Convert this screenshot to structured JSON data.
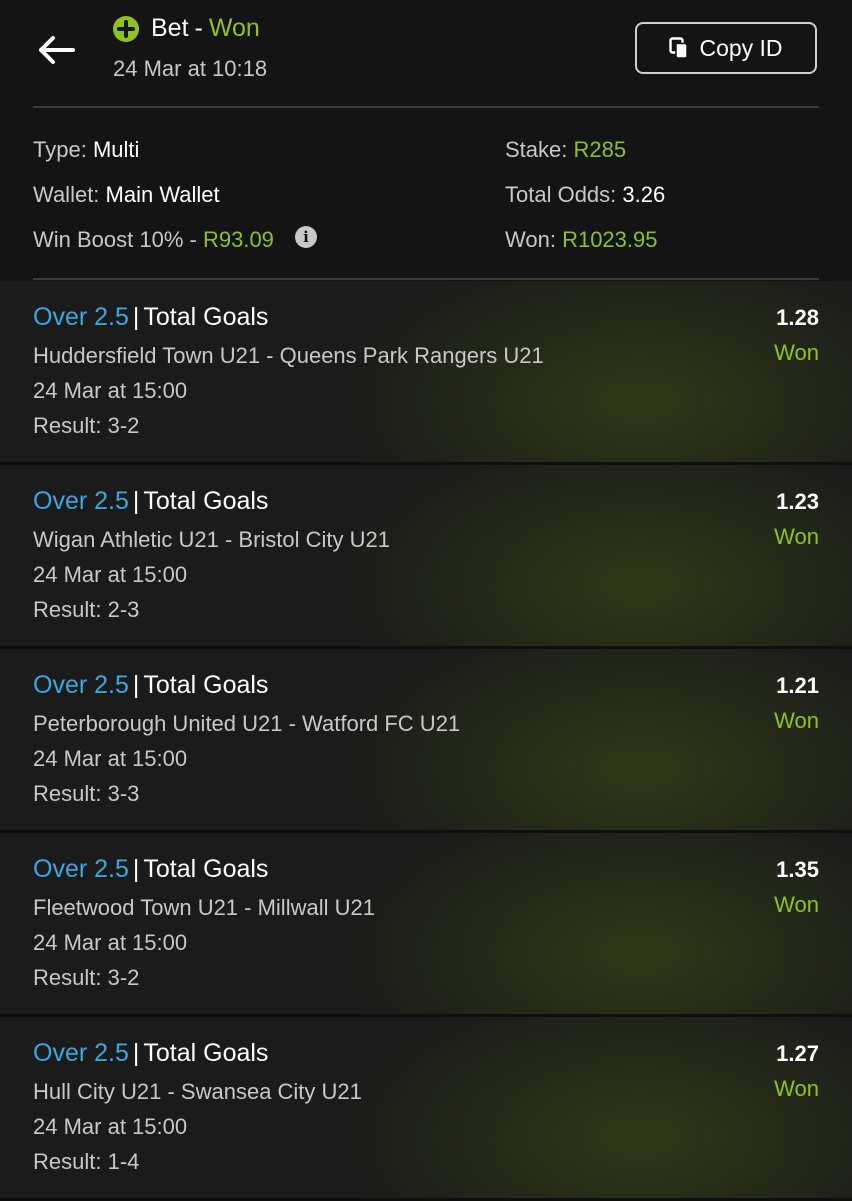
{
  "header": {
    "back_icon": "arrow-left-icon",
    "status_icon": "plus-circle-icon",
    "title_prefix": "Bet",
    "title_separator": "-",
    "title_status": "Won",
    "date": "24 Mar at 10:18",
    "copy_icon": "copy-icon",
    "copy_label": "Copy ID"
  },
  "summary": {
    "type_label": "Type:",
    "type_value": "Multi",
    "wallet_label": "Wallet:",
    "wallet_value": "Main Wallet",
    "boost_label": "Win Boost 10% -",
    "boost_value": "R93.09",
    "info_icon": "info-icon",
    "stake_label": "Stake:",
    "stake_value": "R285",
    "odds_label": "Total Odds:",
    "odds_value": "3.26",
    "won_label": "Won:",
    "won_value": "R1023.95"
  },
  "legs": [
    {
      "selection": "Over 2.5",
      "market": "Total Goals",
      "match": "Huddersfield Town U21 - Queens Park Rangers U21",
      "date": "24 Mar at 15:00",
      "result_label": "Result:",
      "result": "3-2",
      "odds": "1.28",
      "status": "Won"
    },
    {
      "selection": "Over 2.5",
      "market": "Total Goals",
      "match": "Wigan Athletic U21 - Bristol City U21",
      "date": "24 Mar at 15:00",
      "result_label": "Result:",
      "result": "2-3",
      "odds": "1.23",
      "status": "Won"
    },
    {
      "selection": "Over 2.5",
      "market": "Total Goals",
      "match": "Peterborough United U21 - Watford FC U21",
      "date": "24 Mar at 15:00",
      "result_label": "Result:",
      "result": "3-3",
      "odds": "1.21",
      "status": "Won"
    },
    {
      "selection": "Over 2.5",
      "market": "Total Goals",
      "match": "Fleetwood Town U21 - Millwall U21",
      "date": "24 Mar at 15:00",
      "result_label": "Result:",
      "result": "3-2",
      "odds": "1.35",
      "status": "Won"
    },
    {
      "selection": "Over 2.5",
      "market": "Total Goals",
      "match": "Hull City U21 - Swansea City U21",
      "date": "24 Mar at 15:00",
      "result_label": "Result:",
      "result": "1-4",
      "odds": "1.27",
      "status": "Won"
    }
  ],
  "colors": {
    "background": "#141414",
    "accent_green": "#8ec21f",
    "selection_blue": "#3aa8e0",
    "muted_text": "#c8c8c8"
  }
}
